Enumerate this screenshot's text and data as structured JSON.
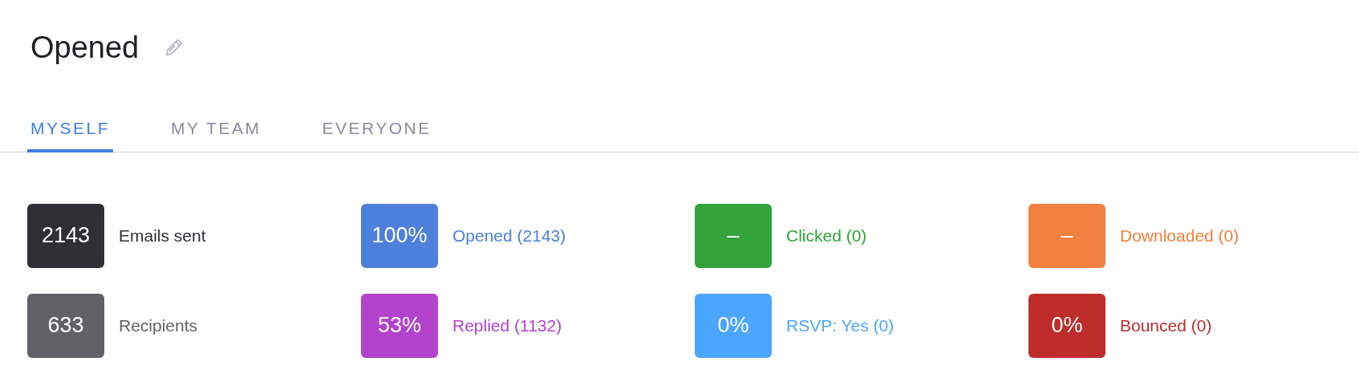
{
  "title": "Opened",
  "tabs": [
    {
      "label": "MYSELF",
      "selected": true
    },
    {
      "label": "MY TEAM",
      "selected": false
    },
    {
      "label": "EVERYONE",
      "selected": false
    }
  ],
  "stats": [
    {
      "value": "2143",
      "label": "Emails sent",
      "color": "#2e3035"
    },
    {
      "value": "100%",
      "label": "Opened (2143)",
      "color": "#4d80db"
    },
    {
      "value": "–",
      "label": "Clicked (0)",
      "color": "#31a33a"
    },
    {
      "value": "–",
      "label": "Downloaded (0)",
      "color": "#f2803e"
    },
    {
      "value": "633",
      "label": "Recipients",
      "color": "#5f6266"
    },
    {
      "value": "53%",
      "label": "Replied (1132)",
      "color": "#b342cc"
    },
    {
      "value": "0%",
      "label": "RSVP: Yes (0)",
      "color": "#4ba6ff"
    },
    {
      "value": "0%",
      "label": "Bounced (0)",
      "color": "#bf2c2c"
    }
  ]
}
